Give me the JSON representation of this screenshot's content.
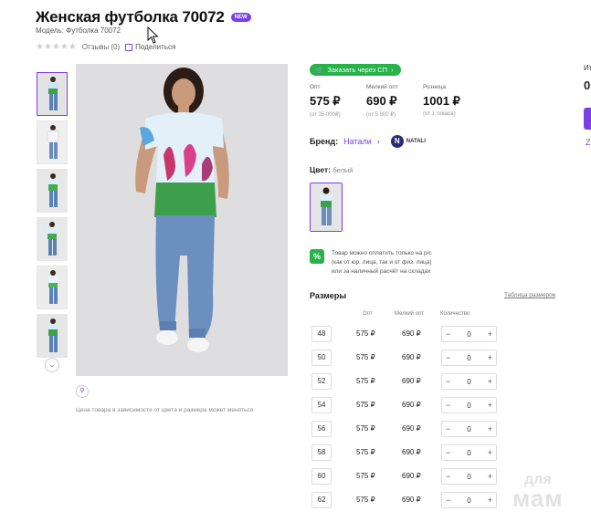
{
  "product": {
    "title": "Женская футболка 70072",
    "badge": "NEW",
    "model": "Модель: Футболка 70072",
    "reviews": "Отзывы (0)",
    "share": "Поделиться",
    "stars": "★★★★★"
  },
  "gallery": {
    "price_note": "Цена товара в зависимости от цвета и размера может меняться"
  },
  "order_button": "Заказать через СП",
  "prices": [
    {
      "label": "Опт",
      "value": "575 ₽",
      "sub": "(от 35 000₽)"
    },
    {
      "label": "Мелкий опт",
      "value": "690 ₽",
      "sub": "(от 5 000 ₽)"
    },
    {
      "label": "Розница",
      "value": "1001 ₽",
      "sub": "(от 1 товара)"
    }
  ],
  "brand": {
    "label": "Бренд:",
    "value": "Натали",
    "logo_text": "NATALI",
    "logo_letter": "N"
  },
  "color": {
    "label": "Цвет:",
    "value": "белый"
  },
  "payment_note": {
    "line1": "Товар можно оплатить только на р/с",
    "line2": "(как от юр. лица, так и от физ. лица)",
    "line3": "или за наличный расчёт на складах",
    "icon": "%"
  },
  "sizes": {
    "title": "Размеры",
    "table_link": "Таблица размеров",
    "headers": {
      "opt": "Опт",
      "small_opt": "Мелкий опт",
      "qty": "Количество"
    },
    "rows": [
      {
        "size": "48",
        "opt": "575 ₽",
        "small_opt": "690 ₽",
        "qty": "0"
      },
      {
        "size": "50",
        "opt": "575 ₽",
        "small_opt": "690 ₽",
        "qty": "0"
      },
      {
        "size": "52",
        "opt": "575 ₽",
        "small_opt": "690 ₽",
        "qty": "0"
      },
      {
        "size": "54",
        "opt": "575 ₽",
        "small_opt": "690 ₽",
        "qty": "0"
      },
      {
        "size": "56",
        "opt": "575 ₽",
        "small_opt": "690 ₽",
        "qty": "0"
      },
      {
        "size": "58",
        "opt": "575 ₽",
        "small_opt": "690 ₽",
        "qty": "0"
      },
      {
        "size": "60",
        "opt": "575 ₽",
        "small_opt": "690 ₽",
        "qty": "0"
      },
      {
        "size": "62",
        "opt": "575 ₽",
        "small_opt": "690 ₽",
        "qty": "0"
      }
    ],
    "minus": "−",
    "plus": "+"
  },
  "right_panel": {
    "label": "Ит",
    "value": "0",
    "link": "Z"
  },
  "watermark": {
    "line1": "для",
    "line2": "мам"
  },
  "colors": {
    "accent": "#7b3fe4",
    "green": "#27b24a"
  }
}
